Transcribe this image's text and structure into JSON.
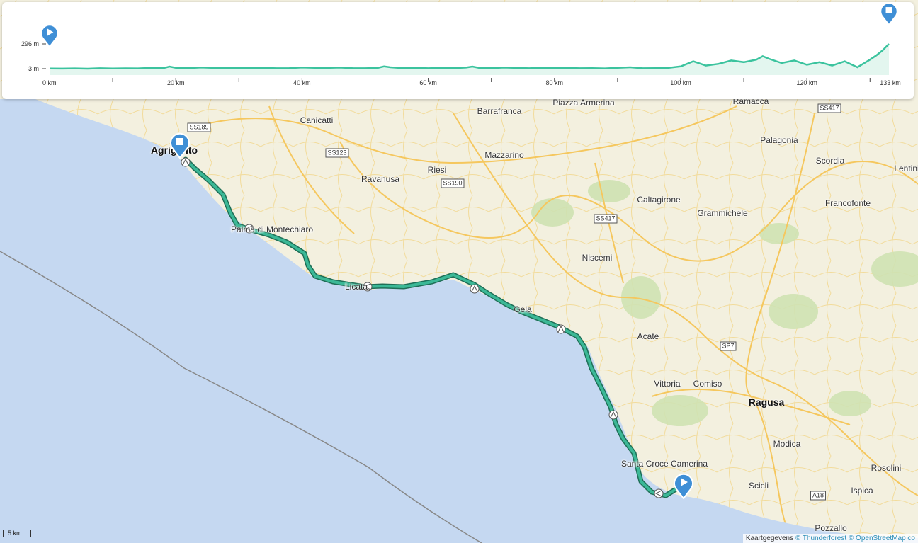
{
  "colors": {
    "route": "#3bb896",
    "route_outline": "#1f6f57",
    "marker": "#3f8fd6",
    "sea": "#c5d8f1",
    "land": "#f3f0df",
    "profile_fill": "#e3f6ef",
    "profile_line": "#3bc39e"
  },
  "elevation_profile": {
    "y_labels": [
      "296 m",
      "3 m"
    ],
    "x_labels": [
      "0 km",
      "20 km",
      "40 km",
      "60 km",
      "80 km",
      "100 km",
      "120 km",
      "133 km"
    ],
    "start_marker_icon": "play-icon",
    "end_marker_icon": "stop-icon"
  },
  "chart_data": {
    "type": "area",
    "xlabel": "",
    "ylabel": "",
    "x_unit": "km",
    "y_unit": "m",
    "xlim": [
      0,
      133
    ],
    "ylim": [
      3,
      296
    ],
    "x": [
      0,
      2,
      4,
      6,
      8,
      10,
      12,
      14,
      16,
      18,
      19,
      20,
      22,
      24,
      26,
      28,
      30,
      32,
      34,
      36,
      38,
      40,
      42,
      44,
      46,
      48,
      50,
      52,
      53,
      54,
      56,
      58,
      60,
      62,
      64,
      66,
      67,
      68,
      70,
      72,
      74,
      76,
      78,
      80,
      82,
      84,
      86,
      88,
      90,
      92,
      94,
      96,
      98,
      100,
      102,
      104,
      106,
      108,
      110,
      112,
      113,
      114,
      116,
      118,
      120,
      122,
      124,
      126,
      128,
      130,
      131,
      132,
      133
    ],
    "y": [
      5,
      4,
      6,
      3,
      8,
      5,
      7,
      6,
      12,
      9,
      28,
      14,
      10,
      18,
      12,
      15,
      10,
      14,
      12,
      8,
      10,
      18,
      14,
      12,
      16,
      10,
      8,
      12,
      30,
      20,
      10,
      14,
      8,
      12,
      10,
      16,
      28,
      14,
      10,
      16,
      12,
      8,
      14,
      10,
      12,
      8,
      10,
      6,
      14,
      20,
      8,
      10,
      12,
      30,
      90,
      40,
      60,
      100,
      80,
      110,
      150,
      120,
      70,
      100,
      50,
      80,
      40,
      90,
      20,
      110,
      160,
      220,
      296
    ]
  },
  "map": {
    "towns": [
      {
        "name": "Agrigento",
        "major": true
      },
      {
        "name": "Canicatti"
      },
      {
        "name": "Barrafranca"
      },
      {
        "name": "Piazza Armerina"
      },
      {
        "name": "Ramacca"
      },
      {
        "name": "Palagonia"
      },
      {
        "name": "Scordia"
      },
      {
        "name": "Lentini"
      },
      {
        "name": "Mazzarino"
      },
      {
        "name": "Riesi"
      },
      {
        "name": "Ravanusa"
      },
      {
        "name": "Caltagirone"
      },
      {
        "name": "Grammichele"
      },
      {
        "name": "Francofonte"
      },
      {
        "name": "Palma di Montechiaro"
      },
      {
        "name": "Niscemi"
      },
      {
        "name": "Gela"
      },
      {
        "name": "Licata"
      },
      {
        "name": "Acate"
      },
      {
        "name": "Vittoria"
      },
      {
        "name": "Comiso"
      },
      {
        "name": "Ragusa",
        "major": true
      },
      {
        "name": "Modica"
      },
      {
        "name": "Santa Croce Camerina"
      },
      {
        "name": "Scicli"
      },
      {
        "name": "Rosolini"
      },
      {
        "name": "Ispica"
      },
      {
        "name": "Pozzallo"
      }
    ],
    "road_shields": [
      "SS189",
      "SS123",
      "SS190",
      "SS417",
      "SS417",
      "SP7",
      "A18"
    ],
    "start_marker_icon": "play-icon",
    "end_marker_icon": "stop-icon"
  },
  "scale_bar": {
    "label": "5 km"
  },
  "attribution": {
    "prefix": "Kaartgegevens",
    "source1": "© Thunderforest",
    "source2": "© OpenStreetMap co"
  }
}
